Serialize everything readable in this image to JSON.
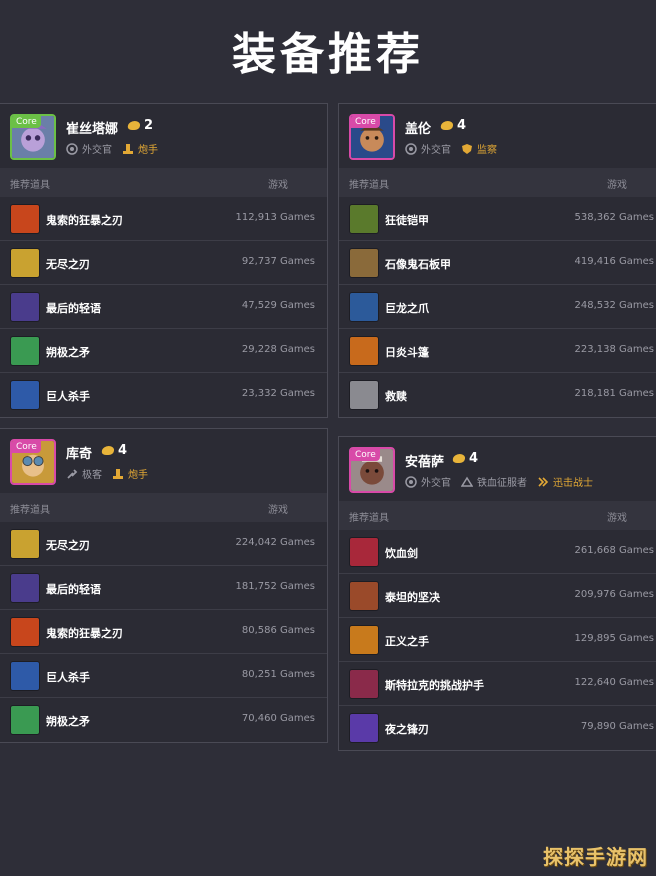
{
  "page": {
    "title": "装备推荐",
    "watermark": "探探手游网"
  },
  "table_headers": {
    "items": "推荐道具",
    "games": "游戏"
  },
  "cards": [
    {
      "champion": "崔丝塔娜",
      "tier": "2",
      "badge": "Core",
      "roles": [
        {
          "label": "外交官",
          "gold": false
        },
        {
          "label": "炮手",
          "gold": true
        }
      ],
      "items": [
        {
          "name": "鬼索的狂暴之刃",
          "games": "112,913 Games",
          "color": "#c8461c"
        },
        {
          "name": "无尽之刃",
          "games": "92,737 Games",
          "color": "#c9a230"
        },
        {
          "name": "最后的轻语",
          "games": "47,529 Games",
          "color": "#4a3c8c"
        },
        {
          "name": "朔极之矛",
          "games": "29,228 Games",
          "color": "#3a9a52"
        },
        {
          "name": "巨人杀手",
          "games": "23,332 Games",
          "color": "#2e5aa8"
        }
      ]
    },
    {
      "champion": "盖伦",
      "tier": "4",
      "badge": "Core",
      "roles": [
        {
          "label": "外交官",
          "gold": false
        },
        {
          "label": "监察",
          "gold": true
        }
      ],
      "items": [
        {
          "name": "狂徒铠甲",
          "games": "538,362 Games",
          "color": "#5a7a2c"
        },
        {
          "name": "石像鬼石板甲",
          "games": "419,416 Games",
          "color": "#8a6a3a"
        },
        {
          "name": "巨龙之爪",
          "games": "248,532 Games",
          "color": "#2c5a9a"
        },
        {
          "name": "日炎斗篷",
          "games": "223,138 Games",
          "color": "#c86a1c"
        },
        {
          "name": "救赎",
          "games": "218,181 Games",
          "color": "#8a8a90"
        }
      ]
    },
    {
      "champion": "库奇",
      "tier": "4",
      "badge": "Core",
      "roles": [
        {
          "label": "极客",
          "gold": false
        },
        {
          "label": "炮手",
          "gold": true
        }
      ],
      "items": [
        {
          "name": "无尽之刃",
          "games": "224,042 Games",
          "color": "#c9a230"
        },
        {
          "name": "最后的轻语",
          "games": "181,752 Games",
          "color": "#4a3c8c"
        },
        {
          "name": "鬼索的狂暴之刃",
          "games": "80,586 Games",
          "color": "#c8461c"
        },
        {
          "name": "巨人杀手",
          "games": "80,251 Games",
          "color": "#2e5aa8"
        },
        {
          "name": "朔极之矛",
          "games": "70,460 Games",
          "color": "#3a9a52"
        }
      ]
    },
    {
      "champion": "安蓓萨",
      "tier": "4",
      "badge": "Core",
      "roles": [
        {
          "label": "外交官",
          "gold": false
        },
        {
          "label": "铁血征服者",
          "gold": false
        },
        {
          "label": "迅击战士",
          "gold": true
        }
      ],
      "items": [
        {
          "name": "饮血剑",
          "games": "261,668 Games",
          "color": "#a8283a"
        },
        {
          "name": "泰坦的坚决",
          "games": "209,976 Games",
          "color": "#9a4a2a"
        },
        {
          "name": "正义之手",
          "games": "129,895 Games",
          "color": "#c87a1c"
        },
        {
          "name": "斯特拉克的挑战护手",
          "games": "122,640 Games",
          "color": "#8a2a4a"
        },
        {
          "name": "夜之锋刃",
          "games": "79,890 Games",
          "color": "#5a3aa8"
        }
      ]
    }
  ],
  "colors": {
    "core_green": "#6bc046",
    "core_pink": "#d84aa8",
    "gold": "#e2a835"
  }
}
